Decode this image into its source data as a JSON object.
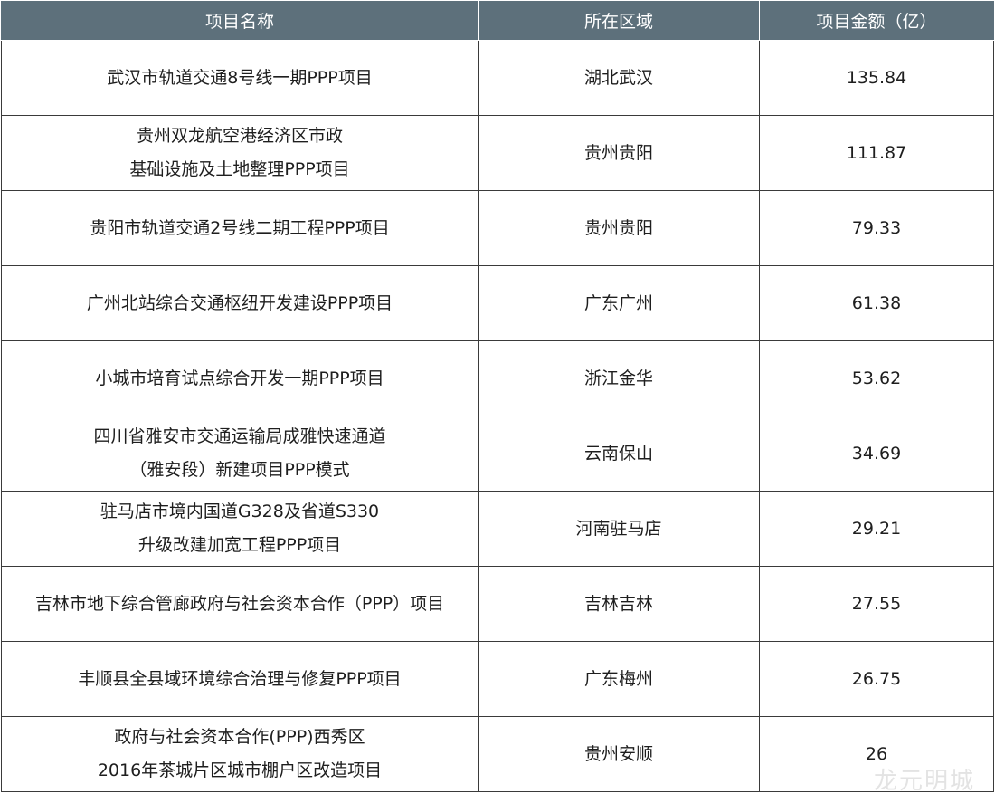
{
  "table": {
    "headers": [
      "项目名称",
      "所在区域",
      "项目金额（亿）"
    ],
    "rows": [
      {
        "name_lines": [
          "武汉市轨道交通8号线一期PPP项目"
        ],
        "region": "湖北武汉",
        "amount": "135.84"
      },
      {
        "name_lines": [
          "贵州双龙航空港经济区市政",
          "基础设施及土地整理PPP项目"
        ],
        "region": "贵州贵阳",
        "amount": "111.87"
      },
      {
        "name_lines": [
          "贵阳市轨道交通2号线二期工程PPP项目"
        ],
        "region": "贵州贵阳",
        "amount": "79.33"
      },
      {
        "name_lines": [
          "广州北站综合交通枢纽开发建设PPP项目"
        ],
        "region": "广东广州",
        "amount": "61.38"
      },
      {
        "name_lines": [
          "小城市培育试点综合开发一期PPP项目"
        ],
        "region": "浙江金华",
        "amount": "53.62"
      },
      {
        "name_lines": [
          "四川省雅安市交通运输局成雅快速通道",
          "（雅安段）新建项目PPP模式"
        ],
        "region": "云南保山",
        "amount": "34.69"
      },
      {
        "name_lines": [
          "驻马店市境内国道G328及省道S330",
          "升级改建加宽工程PPP项目"
        ],
        "region": "河南驻马店",
        "amount": "29.21"
      },
      {
        "name_lines": [
          "吉林市地下综合管廊政府与社会资本合作（PPP）项目"
        ],
        "region": "吉林吉林",
        "amount": "27.55"
      },
      {
        "name_lines": [
          "丰顺县全县域环境综合治理与修复PPP项目"
        ],
        "region": "广东梅州",
        "amount": "26.75"
      },
      {
        "name_lines": [
          "政府与社会资本合作(PPP)西秀区",
          "2016年茶城片区城市棚户区改造项目"
        ],
        "region": "贵州安顺",
        "amount": "26"
      }
    ]
  },
  "watermark": "龙元明城",
  "colors": {
    "header_bg": "#5d707b",
    "header_text": "#ffffff",
    "grid_line": "#3a3a3a",
    "body_text": "#1e1e1e",
    "watermark": "#e3e3e3"
  }
}
